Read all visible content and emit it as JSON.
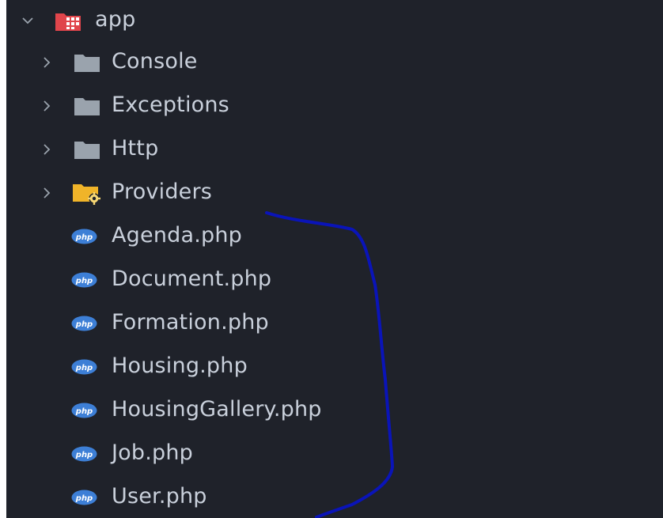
{
  "tree": {
    "root": {
      "label": "app",
      "expanded": true,
      "icon": "folder-app-icon"
    },
    "folders": [
      {
        "label": "Console",
        "icon": "folder-icon"
      },
      {
        "label": "Exceptions",
        "icon": "folder-icon"
      },
      {
        "label": "Http",
        "icon": "folder-icon"
      },
      {
        "label": "Providers",
        "icon": "folder-config-icon"
      }
    ],
    "files": [
      {
        "label": "Agenda.php",
        "icon": "php-file-icon"
      },
      {
        "label": "Document.php",
        "icon": "php-file-icon"
      },
      {
        "label": "Formation.php",
        "icon": "php-file-icon"
      },
      {
        "label": "Housing.php",
        "icon": "php-file-icon"
      },
      {
        "label": "HousingGallery.php",
        "icon": "php-file-icon"
      },
      {
        "label": "Job.php",
        "icon": "php-file-icon"
      },
      {
        "label": "User.php",
        "icon": "php-file-icon"
      }
    ]
  },
  "colors": {
    "background": "#1f222a",
    "text": "#c9d0db",
    "folder_grey": "#9aa3ad",
    "folder_app_red": "#e0454b",
    "folder_config_yellow": "#f0b429",
    "php_blue": "#3d7fd6",
    "annotation_blue": "#0a14b8"
  }
}
